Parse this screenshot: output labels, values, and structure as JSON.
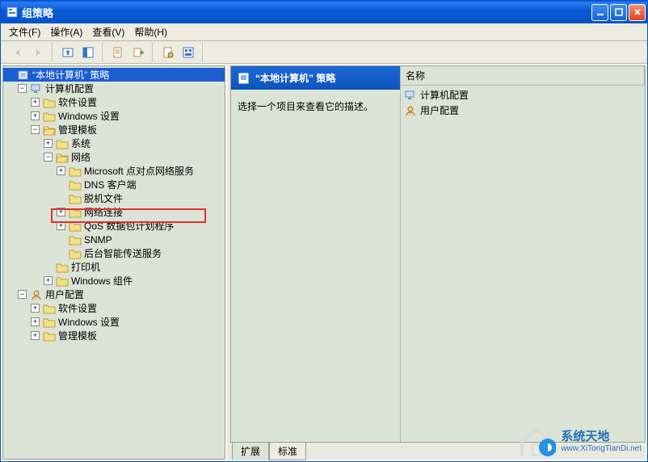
{
  "window": {
    "title": "组策略"
  },
  "menu": {
    "file": "文件(F)",
    "action": "操作(A)",
    "view": "查看(V)",
    "help": "帮助(H)"
  },
  "tree": {
    "root": "“本地计算机” 策略",
    "computer_config": "计算机配置",
    "software_settings": "软件设置",
    "windows_settings": "Windows 设置",
    "admin_templates": "管理模板",
    "system": "系统",
    "network": "网络",
    "ms_p2p": "Microsoft 点对点网络服务",
    "dns_client": "DNS 客户端",
    "offline_files": "脱机文件",
    "network_connections": "网络连接",
    "qos": "QoS 数据包计划程序",
    "snmp": "SNMP",
    "bits": "后台智能传送服务",
    "printers": "打印机",
    "windows_components": "Windows 组件",
    "user_config": "用户配置",
    "uc_software": "软件设置",
    "uc_windows": "Windows 设置",
    "uc_admin": "管理模板"
  },
  "right": {
    "header": "“本地计算机” 策略",
    "desc": "选择一个项目来查看它的描述。",
    "col_name": "名称",
    "item_computer": "计算机配置",
    "item_user": "用户配置"
  },
  "tabs": {
    "extended": "扩展",
    "standard": "标准"
  },
  "watermark": {
    "main": "系统天地",
    "sub": "www.XiTongTianDi.net"
  }
}
